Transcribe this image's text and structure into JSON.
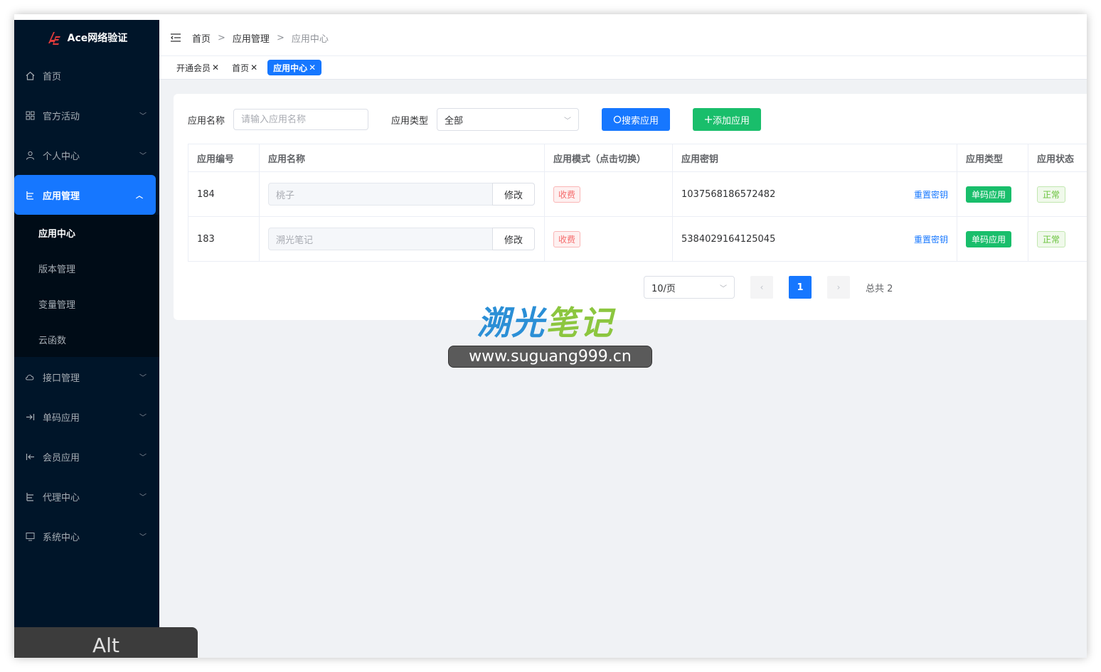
{
  "sidebar": {
    "brand": "Ace网络验证",
    "items": [
      {
        "label": "首页"
      },
      {
        "label": "官方活动"
      },
      {
        "label": "个人中心"
      },
      {
        "label": "应用管理"
      },
      {
        "label": "接口管理"
      },
      {
        "label": "单码应用"
      },
      {
        "label": "会员应用"
      },
      {
        "label": "代理中心"
      },
      {
        "label": "系统中心"
      }
    ],
    "submenu": [
      {
        "label": "应用中心"
      },
      {
        "label": "版本管理"
      },
      {
        "label": "变量管理"
      },
      {
        "label": "云函数"
      }
    ]
  },
  "header": {
    "breadcrumb": [
      "首页",
      "应用管理",
      "应用中心"
    ],
    "sep": ">"
  },
  "tags": [
    {
      "label": "开通会员"
    },
    {
      "label": "首页"
    },
    {
      "label": "应用中心"
    }
  ],
  "tag_close": "✕",
  "filters": {
    "name_label": "应用名称",
    "name_placeholder": "请输入应用名称",
    "type_label": "应用类型",
    "type_value": "全部",
    "search_btn": "搜索应用",
    "add_btn": "添加应用"
  },
  "table": {
    "headers": [
      "应用编号",
      "应用名称",
      "应用模式（点击切换）",
      "应用密钥",
      "应用类型",
      "应用状态"
    ],
    "edit_label": "修改",
    "reset_label": "重置密钥",
    "rows": [
      {
        "id": "184",
        "name": "桃子",
        "mode": "收费",
        "secret": "1037568186572482",
        "type": "单码应用",
        "status": "正常"
      },
      {
        "id": "183",
        "name": "溯光笔记",
        "mode": "收费",
        "secret": "5384029164125045",
        "type": "单码应用",
        "status": "正常"
      }
    ]
  },
  "pagination": {
    "page_size": "10/页",
    "current_page": "1",
    "total": "总共 2"
  },
  "watermark": {
    "title_part1": "溯光",
    "title_part2": "笔记",
    "url": "www.suguang999.cn"
  },
  "overlay_key": "Alt",
  "colors": {
    "sidebar_bg": "#001529",
    "primary": "#1677ff",
    "success": "#19be6b",
    "danger": "#f56c6c"
  }
}
